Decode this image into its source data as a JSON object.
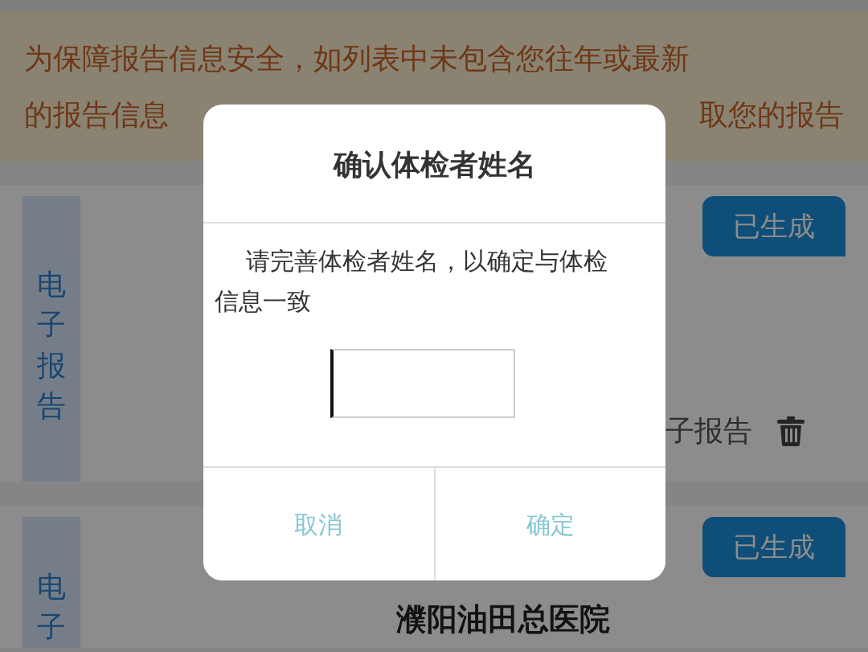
{
  "notice": {
    "line_1": "为保障报告信息安全，如列表中未包含您往年或最新",
    "line_2_start": "的报告信息",
    "line_2_end": "取您的报告"
  },
  "reports": [
    {
      "side_label": "电子报告",
      "status": "已生成",
      "action": "子报告",
      "deletable": true
    },
    {
      "side_label": "电子",
      "status": "已生成",
      "hospital": "濮阳油田总医院",
      "deletable": false
    }
  ],
  "dialog": {
    "title": "确认体检者姓名",
    "message": "请完善体检者姓名，以确定与体检信息一致",
    "name_field": {
      "focused": true
    },
    "buttons": [
      "取消",
      "确定"
    ]
  }
}
